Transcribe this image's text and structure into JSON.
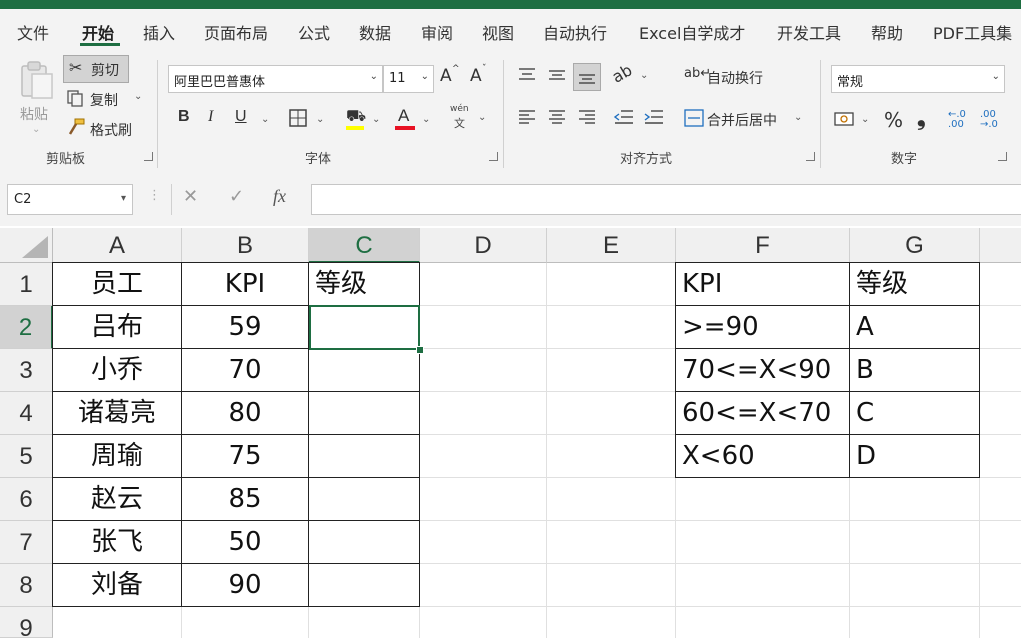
{
  "ribbon_tabs": [
    "文件",
    "开始",
    "插入",
    "页面布局",
    "公式",
    "数据",
    "审阅",
    "视图",
    "自动执行",
    "Excel自学成才",
    "开发工具",
    "帮助",
    "PDF工具集"
  ],
  "active_tab": "开始",
  "clipboard": {
    "paste": "粘贴",
    "cut": "剪切",
    "copy": "复制",
    "format_painter": "格式刷",
    "group": "剪贴板"
  },
  "font": {
    "name": "阿里巴巴普惠体",
    "size": "11",
    "grow": "A",
    "shrink": "A",
    "bold": "B",
    "italic": "I",
    "underline": "U",
    "font_color": "A",
    "phonetic_top": "wén",
    "phonetic_bottom": "文",
    "group": "字体"
  },
  "alignment": {
    "wrap_text": "自动换行",
    "merge_center": "合并后居中",
    "group": "对齐方式"
  },
  "number": {
    "format": "常规",
    "percent": "%",
    "comma": "❟",
    "increase_decimal": "←.0 .00",
    "decrease_decimal": ".00 →.0",
    "group": "数字"
  },
  "name_box": "C2",
  "formula_controls": {
    "cancel": "✕",
    "enter": "✓",
    "fx": "fx"
  },
  "formula_value": "",
  "columns": [
    "A",
    "B",
    "C",
    "D",
    "E",
    "F",
    "G"
  ],
  "selected_column": "C",
  "rows": [
    "1",
    "2",
    "3",
    "4",
    "5",
    "6",
    "7",
    "8",
    "9"
  ],
  "selected_row": "2",
  "table_main": {
    "headers": [
      "员工",
      "KPI",
      "等级"
    ],
    "rows": [
      [
        "吕布",
        "59",
        ""
      ],
      [
        "小乔",
        "70",
        ""
      ],
      [
        "诸葛亮",
        "80",
        ""
      ],
      [
        "周瑜",
        "75",
        ""
      ],
      [
        "赵云",
        "85",
        ""
      ],
      [
        "张飞",
        "50",
        ""
      ],
      [
        "刘备",
        "90",
        ""
      ]
    ]
  },
  "table_lookup": {
    "headers": [
      "KPI",
      "等级"
    ],
    "rows": [
      [
        ">=90",
        "A"
      ],
      [
        "70<=X<90",
        "B"
      ],
      [
        "60<=X<70",
        "C"
      ],
      [
        "X<60",
        "D"
      ]
    ]
  },
  "colors": {
    "accent": "#1e6e42",
    "ribbon_bg": "#f3f3f3",
    "font_color_bar": "#e81123",
    "highlight": "#ffff00"
  }
}
